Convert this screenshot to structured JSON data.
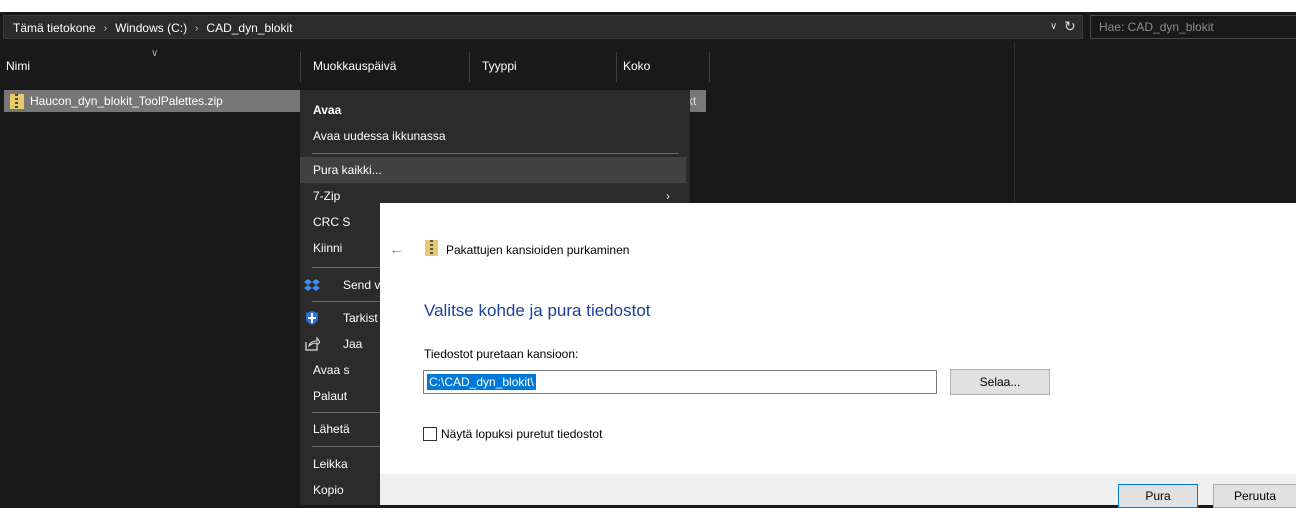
{
  "explorer": {
    "breadcrumb": [
      "Tämä tietokone",
      "Windows (C:)",
      "CAD_dyn_blokit"
    ],
    "search_placeholder": "Hae: CAD_dyn_blokit",
    "columns": [
      "Nimi",
      "Muokkauspäivä",
      "Tyyppi",
      "Koko"
    ],
    "file_name": "Haucon_dyn_blokit_ToolPalettes.zip",
    "row_peek_text": "kt"
  },
  "context_menu": {
    "items": [
      {
        "label": "Avaa",
        "bold": true
      },
      {
        "label": "Avaa uudessa ikkunassa"
      },
      {
        "label": "Pura kaikki..."
      },
      {
        "label": "7-Zip"
      },
      {
        "label": "CRC S"
      },
      {
        "label": "Kiinni"
      },
      {
        "label": "Send v",
        "icon": "dropbox-icon"
      },
      {
        "label": "Tarkist",
        "icon": "shield-icon"
      },
      {
        "label": "Jaa",
        "icon": "share-icon"
      },
      {
        "label": "Avaa s"
      },
      {
        "label": "Palaut"
      },
      {
        "label": "Lähetä"
      },
      {
        "label": "Leikka"
      },
      {
        "label": "Kopio"
      }
    ]
  },
  "dialog": {
    "title": "Pakattujen kansioiden purkaminen",
    "heading": "Valitse kohde ja pura tiedostot",
    "field_label": "Tiedostot puretaan kansioon:",
    "path_value": "C:\\CAD_dyn_blokit\\",
    "browse_label": "Selaa...",
    "checkbox_label": "Näytä lopuksi puretut tiedostot",
    "extract_label": "Pura",
    "cancel_label": "Peruuta"
  }
}
